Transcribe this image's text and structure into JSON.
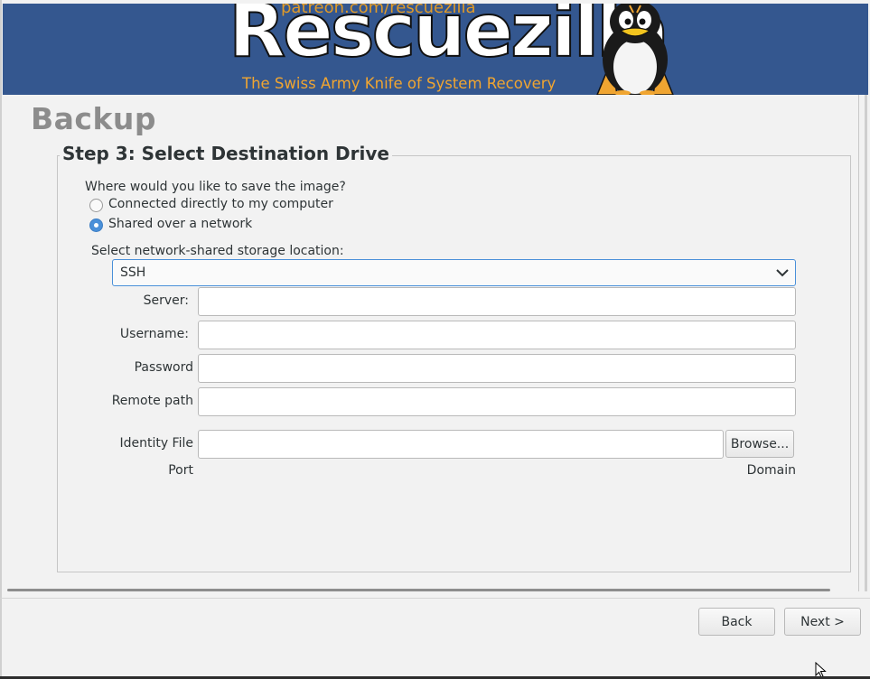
{
  "banner": {
    "url_text": "patreon.com/rescuezilla",
    "logo_text": "Rescuezilla",
    "tagline": "The Swiss Army Knife of System Recovery"
  },
  "page": {
    "title": "Backup"
  },
  "step": {
    "title": "Step 3: Select Destination Drive",
    "question": "Where would you like to save the image?",
    "options": [
      {
        "label": "Connected directly to my computer",
        "selected": false
      },
      {
        "label": "Shared over a network",
        "selected": true
      }
    ],
    "storage_label": "Select network-shared storage location:",
    "storage_selected": "SSH"
  },
  "form": {
    "server_label": "Server:",
    "server_value": "",
    "username_label": "Username:",
    "username_value": "",
    "password_label": "Password",
    "password_value": "",
    "remote_path_label": "Remote path",
    "remote_path_value": "",
    "identity_file_label": "Identity File",
    "identity_file_value": "",
    "browse_label": "Browse...",
    "port_label": "Port",
    "domain_label": "Domain"
  },
  "nav": {
    "back_label": "Back",
    "next_label": "Next >"
  },
  "colors": {
    "banner": "#34578f",
    "accent": "#4a90d9",
    "logo_orange": "#f0a531"
  }
}
